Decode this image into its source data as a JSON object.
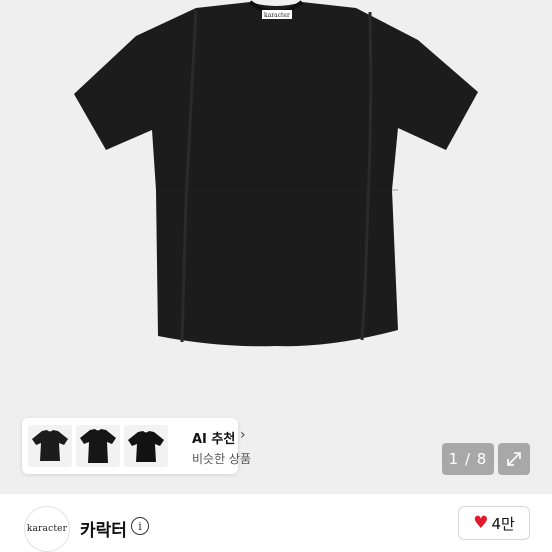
{
  "product": {
    "brand_tag": "karacter",
    "image_alt": "Black short-sleeve t-shirt"
  },
  "ai_recommend": {
    "title": "AI 추천",
    "subtitle": "비슷한 상품",
    "chevron": "chevron-right-icon"
  },
  "pager": {
    "text": "1 / 8",
    "current": 1,
    "total": 8
  },
  "seller": {
    "avatar_text": "karacter",
    "name": "카락터",
    "info_icon": "i"
  },
  "like": {
    "count": "4만",
    "icon": "heart-icon",
    "color": "#e21b2c"
  },
  "colors": {
    "background": "#efefef",
    "shirt": "#1c1c1c"
  }
}
